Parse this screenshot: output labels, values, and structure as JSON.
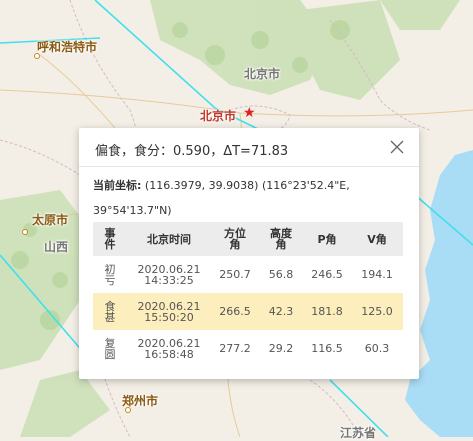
{
  "map": {
    "labels": {
      "hohhot": "呼和浩特市",
      "beijing_top": "北京市",
      "beijing": "北京市",
      "taiyuan": "太原市",
      "shanxi": "山西",
      "zhengzhou": "郑州市",
      "jiangsu": "江苏省"
    },
    "colors": {
      "eclipse_line": "#3ee0ee",
      "sea": "#a9dcf5",
      "land": "#f3efe6",
      "marker": "#e02020"
    }
  },
  "popup": {
    "title": "偏食，食分：0.590，ΔT=71.83",
    "coord_label": "当前坐标:",
    "coord_value": " (116.3979, 39.9038) (116°23'52.4\"E, 39°54'13.7\"N)",
    "close_icon": "close-icon",
    "columns": [
      "事件",
      "北京时间",
      "方位角",
      "高度角",
      "P角",
      "V角"
    ],
    "rows": [
      {
        "event": "初亏",
        "time": "2020.06.21 14:33:25",
        "azimuth": "250.7",
        "altitude": "56.8",
        "p": "246.5",
        "v": "194.1",
        "highlight": false
      },
      {
        "event": "食甚",
        "time": "2020.06.21 15:50:20",
        "azimuth": "266.5",
        "altitude": "42.3",
        "p": "181.8",
        "v": "125.0",
        "highlight": true
      },
      {
        "event": "复圆",
        "time": "2020.06.21 16:58:48",
        "azimuth": "277.2",
        "altitude": "29.2",
        "p": "116.5",
        "v": "60.3",
        "highlight": false
      }
    ]
  }
}
